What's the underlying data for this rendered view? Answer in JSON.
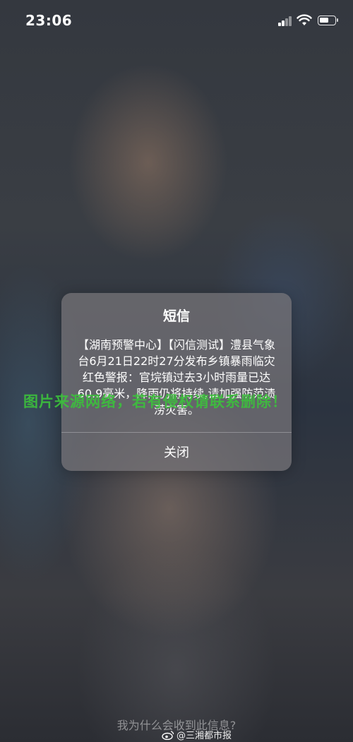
{
  "status_bar": {
    "time": "23:06",
    "icons": [
      "cellular-signal-icon",
      "wifi-icon",
      "battery-icon"
    ]
  },
  "alert": {
    "title": "短信",
    "message": "【湖南预警中心】【闪信测试】澧县气象台6月21日22时27分发布乡镇暴雨临灾红色警报：官垸镇过去3小时雨量已达60.9毫米，降雨仍将持续,请加强防范渍涝灾害。",
    "close_label": "关闭"
  },
  "watermark": {
    "text": "图片来源网络，若有侵权请联系删除！",
    "color": "#3cc23c"
  },
  "footer": {
    "why_link": "我为什么会收到此信息?",
    "credit": "@三湘都市报",
    "credit_icon": "weibo-icon"
  }
}
